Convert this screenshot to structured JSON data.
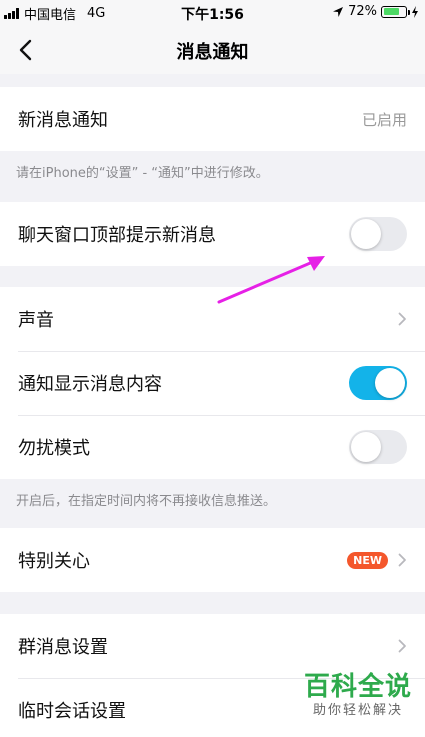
{
  "status_bar": {
    "carrier": "中国电信",
    "network": "4G",
    "time": "下午1:56",
    "battery": "72%",
    "battery_level": 0.72
  },
  "nav": {
    "title": "消息通知"
  },
  "settings": {
    "new_message": {
      "label": "新消息通知",
      "value": "已启用"
    },
    "system_note": "请在iPhone的“设置” - “通知”中进行修改。",
    "chat_top_tip": {
      "label": "聊天窗口顶部提示新消息",
      "enabled": false
    },
    "sound": {
      "label": "声音"
    },
    "show_content": {
      "label": "通知显示消息内容",
      "enabled": true
    },
    "dnd": {
      "label": "勿扰模式",
      "enabled": false
    },
    "dnd_note": "开启后，在指定时间内将不再接收信息推送。",
    "special_care": {
      "label": "特别关心",
      "badge": "NEW"
    },
    "group_settings": {
      "label": "群消息设置"
    },
    "temp_chat": {
      "label": "临时会话设置"
    }
  },
  "watermark": {
    "main": "百科全说",
    "sub": "助你轻松解决"
  },
  "colors": {
    "accent": "#13b3e9",
    "badge": "#f4572c",
    "arrow": "#e620e6",
    "watermark": "#2eaa4c"
  }
}
